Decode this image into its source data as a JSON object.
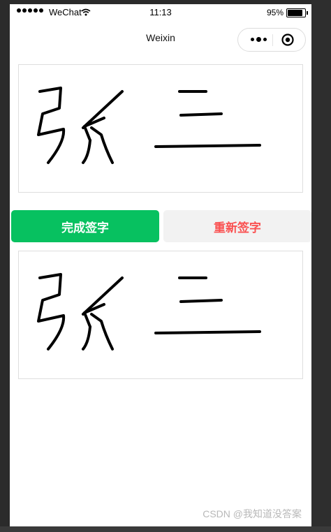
{
  "status_bar": {
    "carrier": "WeChat",
    "time": "11:13",
    "battery": "95%",
    "battery_level": 0.95,
    "icons": [
      "signal-dots-icon",
      "wifi-icon",
      "battery-icon"
    ]
  },
  "nav": {
    "title": "Weixin",
    "icons": [
      "more-icon",
      "close-target-icon"
    ]
  },
  "signature": {
    "text": "张 三"
  },
  "buttons": {
    "done_label": "完成签字",
    "redo_label": "重新签字"
  },
  "colors": {
    "primary": "#07c160",
    "danger_text": "#fa5151",
    "secondary_bg": "#f2f2f2"
  },
  "watermark": "CSDN @我知道没答案"
}
